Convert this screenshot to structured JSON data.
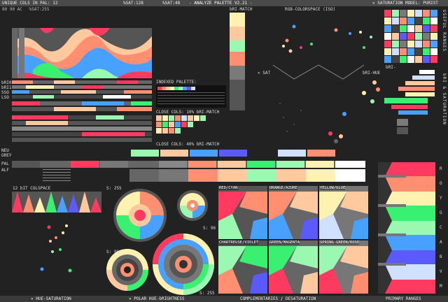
{
  "header": {
    "unique_cols": "UNIQUE COLS IN PAL: 12",
    "row2": "80 90 AC",
    "sat_a": "%SAT:255",
    "sat_b": "%SAT:128",
    "sat_c": "%SAT:48",
    "title": "- ANALYZE PALETTE V2.21 -",
    "bri_match": "bRI-MATCH",
    "rgb_space": "RGB-COLORSPACE (ISO)",
    "sat_model": "✕ SATURATION MODEL: PURIST"
  },
  "left_labels": {
    "bri0": "bRI0",
    "bri1": "bRI1",
    "sso": "SSO",
    "lso": "LSO",
    "neu": "NEU",
    "grey": "GREY",
    "pal": "PAL",
    "alf": "ALF"
  },
  "panels": {
    "indexed_palette": "INDEXED PALETTE:",
    "close_cols_10": "CLOSE COLS: 10% bRI-MATCH",
    "close_cols_40": "CLOSE COLS: 40% bRI-MATCH",
    "sat_x": "✕ SAT",
    "bri_hue": "bRI-HUE",
    "bri_small": "bRI-",
    "colspace_12bit": "12 bIT COLSPACE",
    "s255_a": "S: 255",
    "s96_a": "S: 96",
    "s96_b": "S: 96",
    "s255_b": "S: 255",
    "red_cyan": "RED/CYAN",
    "orange_azure": "ORANGE/AZURE",
    "yellow_blue": "YELLOW/bLUE",
    "chartreuse_violet": "CHARTREUSE/VIOLET",
    "green_magenta": "GREEN/MAGENTA",
    "spring_rose": "SPRING-GREEN/ROSE"
  },
  "side_titles": {
    "useful_ranges": "USEFUL RANGES",
    "bri_sat": "bRI & SATURATION",
    "hue_letters": [
      "R",
      "O",
      "Y",
      "G",
      "C",
      "A",
      "B",
      "V",
      "M"
    ]
  },
  "footer": {
    "hue_sat": "✕ HUE-SATURATION",
    "polar": "✕ POLAR HUE-bRIGHTNESS",
    "complementaries": "COMPLEMENTARIES / DESATURATION",
    "primary_ranges": "PRIMARY RANGES"
  },
  "colors": {
    "bg": "#222222",
    "bar": "#4a4a4a",
    "pal": [
      "#ff3a60",
      "#ff8f70",
      "#ffc9a0",
      "#fff2b0",
      "#3af070",
      "#9af8b0",
      "#48a0ff",
      "#5a5aff",
      "#d0e0ff",
      "#ffffff",
      "#7a7a7a",
      "#444444"
    ]
  }
}
